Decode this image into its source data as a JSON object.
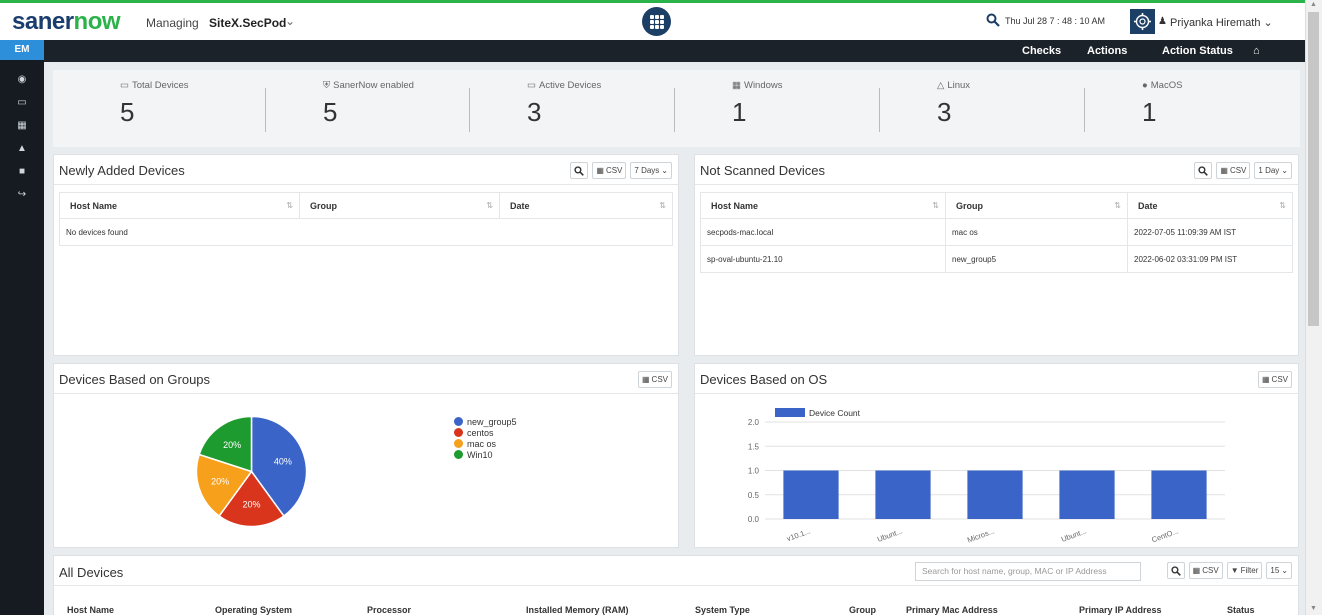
{
  "header": {
    "logo_part1": "saner",
    "logo_part2": "now",
    "managing_label": "Managing",
    "site": "SiteX.SecPod",
    "datetime": "Thu Jul 28  7 : 48 : 10 AM",
    "user": "Priyanka Hiremath"
  },
  "leftnav": {
    "active": "EM",
    "icons": [
      "eye-icon",
      "monitor-icon",
      "calendar-icon",
      "warning-icon",
      "book-icon",
      "logout-icon"
    ]
  },
  "actionbar": {
    "checks": "Checks",
    "actions": "Actions",
    "action_status": "Action Status"
  },
  "stats": [
    {
      "label": "Total Devices",
      "value": "5",
      "icon": "monitor-icon"
    },
    {
      "label": "SanerNow enabled",
      "value": "5",
      "icon": "shield-icon"
    },
    {
      "label": "Active Devices",
      "value": "3",
      "icon": "laptop-icon"
    },
    {
      "label": "Windows",
      "value": "1",
      "icon": "windows-icon"
    },
    {
      "label": "Linux",
      "value": "3",
      "icon": "linux-icon"
    },
    {
      "label": "MacOS",
      "value": "1",
      "icon": "apple-icon"
    }
  ],
  "newly_added": {
    "title": "Newly Added Devices",
    "csv": "CSV",
    "range": "7 Days",
    "columns": [
      "Host Name",
      "Group",
      "Date"
    ],
    "empty": "No devices found"
  },
  "not_scanned": {
    "title": "Not Scanned Devices",
    "csv": "CSV",
    "range": "1 Day",
    "columns": [
      "Host Name",
      "Group",
      "Date"
    ],
    "rows": [
      {
        "host": "secpods-mac.local",
        "group": "mac os",
        "date": "2022-07-05 11:09:39 AM IST"
      },
      {
        "host": "sp-oval-ubuntu-21.10",
        "group": "new_group5",
        "date": "2022-06-02 03:31:09 PM IST"
      }
    ]
  },
  "groups_panel": {
    "title": "Devices Based on Groups",
    "csv": "CSV"
  },
  "os_panel": {
    "title": "Devices Based on OS",
    "csv": "CSV"
  },
  "chart_data": [
    {
      "type": "pie",
      "title": "",
      "categories": [
        "new_group5",
        "centos",
        "mac os",
        "Win10"
      ],
      "values": [
        40,
        20,
        20,
        20
      ],
      "labels": [
        "40%",
        "20%",
        "20%",
        "20%"
      ],
      "colors": [
        "#3a64c8",
        "#d9341c",
        "#f7a01b",
        "#1e9b2f"
      ],
      "legend": "right"
    },
    {
      "type": "bar",
      "title": "",
      "categories": [
        "v10.1...",
        "Ubunt...",
        "Micros...",
        "Ubunt...",
        "CentO..."
      ],
      "series": [
        {
          "name": "Device Count",
          "values": [
            1,
            1,
            1,
            1,
            1
          ]
        }
      ],
      "yticks": [
        "2.0",
        "1.5",
        "1.0",
        "0.5",
        "0.0"
      ],
      "ylim": [
        0,
        2
      ],
      "grid": true,
      "legend": "top-left",
      "color": "#3a64c8"
    }
  ],
  "all_devices": {
    "title": "All Devices",
    "search_placeholder": "Search for host name, group, MAC or IP Address",
    "csv": "CSV",
    "filter": "Filter",
    "page_size": "15",
    "columns": [
      "Host Name",
      "Operating System",
      "Processor",
      "Installed Memory (RAM)",
      "System Type",
      "Group",
      "Primary Mac Address",
      "Primary IP Address",
      "Status"
    ]
  }
}
